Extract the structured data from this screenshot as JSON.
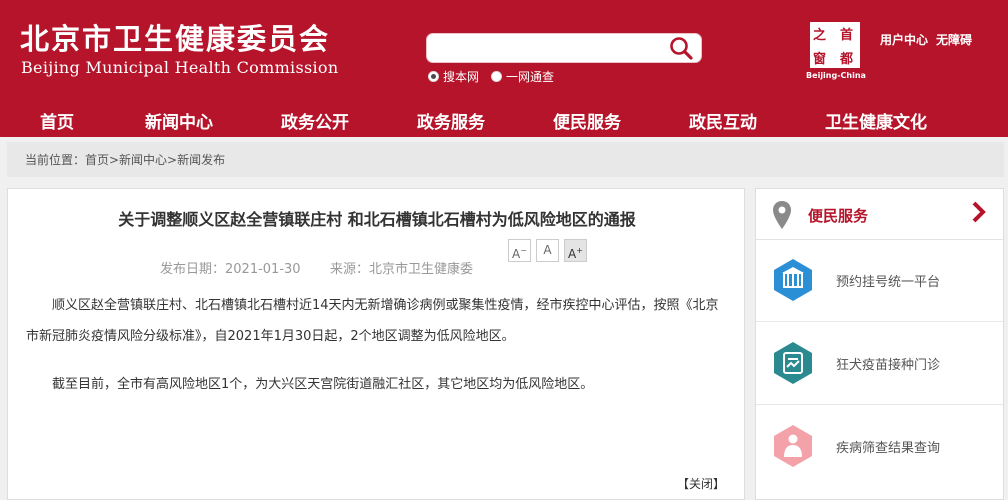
{
  "header": {
    "logo_cn": "北京市卫生健康委员会",
    "logo_en": "Beijing Municipal Health Commission",
    "search": {
      "placeholder": "",
      "value": ""
    },
    "search_scope": [
      {
        "label": "搜本网",
        "selected": true
      },
      {
        "label": "一网通查",
        "selected": false
      }
    ],
    "seal": {
      "chars": [
        "之",
        "首",
        "窗",
        "都"
      ],
      "caption": "Beijing-China"
    },
    "user_center": "用户中心",
    "accessibility": "无障碍",
    "brand_color": "#b5142b"
  },
  "nav": {
    "items": [
      "首页",
      "新闻中心",
      "政务公开",
      "政务服务",
      "便民服务",
      "政民互动",
      "卫生健康文化"
    ]
  },
  "breadcrumb": "当前位置：首页>新闻中心>新闻发布",
  "article": {
    "title": "关于调整顺义区赵全营镇联庄村 和北石槽镇北石槽村为低风险地区的通报",
    "date": "发布日期：2021-01-30",
    "source": "来源：北京市卫生健康委",
    "font_buttons": [
      "A",
      "A",
      "A"
    ],
    "paragraph1_line1": "顺义区赵全营镇联庄村、北石槽镇北石槽村近14天内无新增确诊病例或聚集性疫情，经市疾控中心评估，按照《北京",
    "paragraph1_line2": "市新冠肺炎疫情风险分级标准》，自2021年1月30日起，2个地区调整为低风险地区。",
    "paragraph2": "截至目前，全市有高风险地区1个，为大兴区天宫院街道融汇社区，其它地区均为低风险地区。",
    "close": "【关闭】"
  },
  "sidebar": {
    "title": "便民服务",
    "services": [
      {
        "label": "预约挂号统一平台",
        "icon": "hospital-icon",
        "color": "#2b8fd6"
      },
      {
        "label": "狂犬疫苗接种门诊",
        "icon": "clinic-icon",
        "color": "#2a8a8f"
      },
      {
        "label": "疾病筛查结果查询",
        "icon": "screening-icon",
        "color": "#f2a2a8"
      }
    ]
  }
}
